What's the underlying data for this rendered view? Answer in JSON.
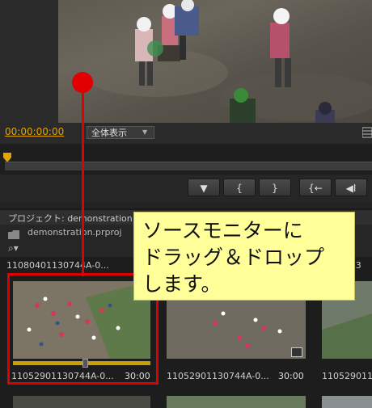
{
  "monitor": {
    "timecode": "00:00:00:00",
    "zoom_option": "全体表示"
  },
  "transport": {
    "buttons": [
      {
        "name": "marker-button",
        "label": "▼"
      },
      {
        "name": "in-point-button",
        "label": "{"
      },
      {
        "name": "out-point-button",
        "label": "}"
      },
      {
        "name": "go-to-in-button",
        "label": "{←"
      },
      {
        "name": "step-back-button",
        "label": "◀I"
      }
    ]
  },
  "project": {
    "tab_label": "プロジェクト: demonstration",
    "file_name": "demonstration.prproj",
    "items": [
      {
        "name": "110804011307​44A-0...",
        "duration": "",
        "top_name": true
      },
      {
        "name": "11052901130744A-0...",
        "duration": "30:00"
      },
      {
        "name": "11052901130744A-0...",
        "duration": "30:00"
      },
      {
        "name": "1105290113",
        "duration": ""
      }
    ],
    "top_row_names": [
      "110804011307​44A-0...",
      "30:00",
      "mp3"
    ]
  },
  "callout": {
    "text": "ソースモニターに\nドラッグ＆ドロップ\nします。"
  },
  "colors": {
    "accent_red": "#e00000",
    "callout_bg": "#ffff99",
    "timecode": "#e3a400"
  }
}
